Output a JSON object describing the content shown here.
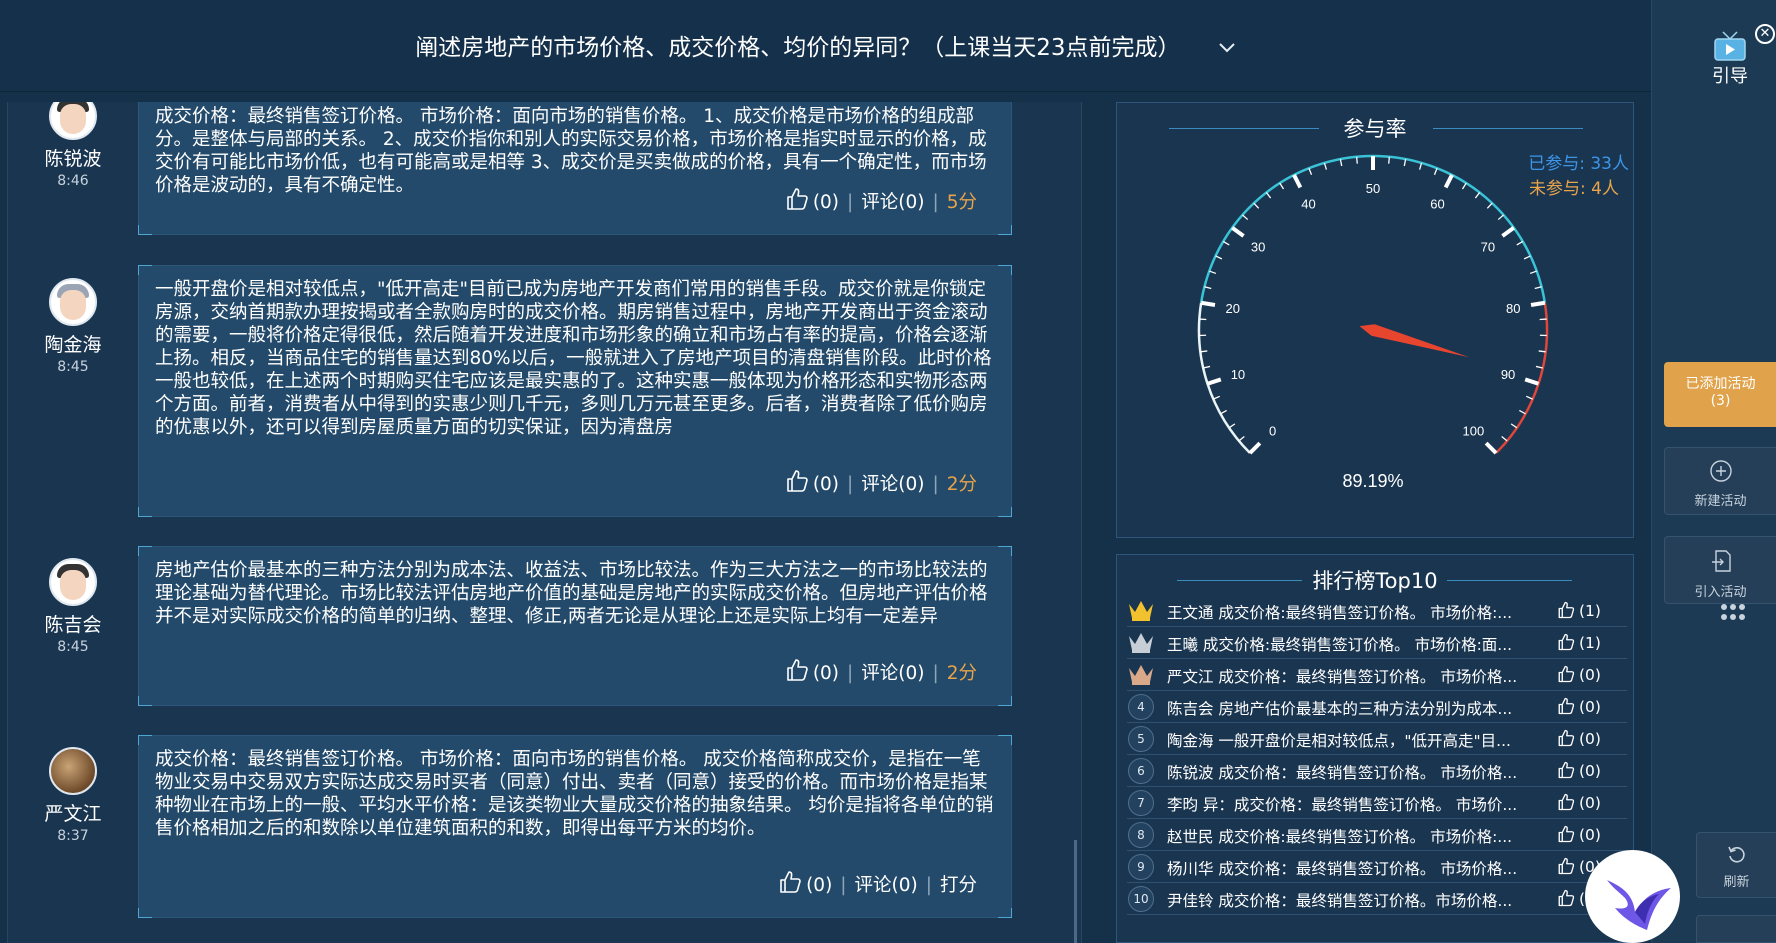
{
  "header": {
    "title": "阐述房地产的市场价格、成交价格、均价的异同？（上课当天23点前完成）"
  },
  "posts": [
    {
      "name": "陈锐波",
      "time": "8:46",
      "text": "成交价格：最终销售签订价格。 市场价格：面向市场的销售价格。 1、成交价格是市场价格的组成部分。是整体与局部的关系。 2、成交价指你和别人的实际交易价格，市场价格是指实时显示的价格，成交价有可能比市场价低，也有可能高或是相等 3、成交价是买卖做成的价格，具有一个确定性，而市场价格是波动的，具有不确定性。",
      "likes": "(0)",
      "comments": "评论(0)",
      "score": "5分"
    },
    {
      "name": "陶金海",
      "time": "8:45",
      "text": "一般开盘价是相对较低点，\"低开高走\"目前已成为房地产开发商们常用的销售手段。成交价就是你锁定房源，交纳首期款办理按揭或者全款购房时的成交价格。期房销售过程中，房地产开发商出于资金滚动的需要，一般将价格定得很低，然后随着开发进度和市场形象的确立和市场占有率的提高，价格会逐渐上扬。相反，当商品住宅的销售量达到80%以后，一般就进入了房地产项目的清盘销售阶段。此时价格一般也较低，在上述两个时期购买住宅应该是最实惠的了。这种实惠一般体现为价格形态和实物形态两个方面。前者，消费者从中得到的实惠少则几千元，多则几万元甚至更多。后者，消费者除了低价购房的优惠以外，还可以得到房屋质量方面的切实保证，因为清盘房",
      "likes": "(0)",
      "comments": "评论(0)",
      "score": "2分"
    },
    {
      "name": "陈吉会",
      "time": "8:45",
      "text": "房地产估价最基本的三种方法分别为成本法、收益法、市场比较法。作为三大方法之一的市场比较法的理论基础为替代理论。市场比较法评估房地产价值的基础是房地产的实际成交价格。但房地产评估价格并不是对实际成交价格的简单的归纳、整理、修正,两者无论是从理论上还是实际上均有一定差异",
      "likes": "(0)",
      "comments": "评论(0)",
      "score": "2分"
    },
    {
      "name": "严文江",
      "time": "8:37",
      "text": "成交价格：最终销售签订价格。 市场价格：面向市场的销售价格。 成交价格简称成交价，是指在一笔物业交易中交易双方实际达成交易时买者（同意）付出、卖者（同意）接受的价格。而市场价格是指某种物业在市场上的一般、平均水平价格：是该类物业大量成交价格的抽象结果。 均价是指将各单位的销售价格相加之后的和数除以单位建筑面积的和数，即得出每平方米的均价。",
      "likes": "(0)",
      "comments": "评论(0)",
      "score": "打分"
    }
  ],
  "participation": {
    "title": "参与率",
    "joined": "已参与: 33人",
    "not_joined": "未参与: 4人",
    "rate_label": "89.19%",
    "rate_value": 89.19,
    "ticks": [
      "0",
      "10",
      "20",
      "30",
      "40",
      "50",
      "60",
      "70",
      "80",
      "90",
      "100"
    ]
  },
  "ranking": {
    "title": "排行榜Top10",
    "rows": [
      {
        "rank": "1",
        "text": "王文通 成交价格:最终销售签订价格。 市场价格:...",
        "likes": "(1)",
        "medal": "gold"
      },
      {
        "rank": "2",
        "text": "王曦 成交价格:最终销售签订价格。 市场价格:面...",
        "likes": "(1)",
        "medal": "silver"
      },
      {
        "rank": "3",
        "text": "严文江 成交价格：最终销售签订价格。 市场价格...",
        "likes": "(0)",
        "medal": "bronze"
      },
      {
        "rank": "4",
        "text": "陈吉会 房地产估价最基本的三种方法分别为成本...",
        "likes": "(0)",
        "medal": ""
      },
      {
        "rank": "5",
        "text": "陶金海 一般开盘价是相对较低点，\"低开高走\"目...",
        "likes": "(0)",
        "medal": ""
      },
      {
        "rank": "6",
        "text": "陈锐波 成交价格：最终销售签订价格。 市场价格...",
        "likes": "(0)",
        "medal": ""
      },
      {
        "rank": "7",
        "text": "李昀 异：成交价格：最终销售签订价格。 市场价...",
        "likes": "(0)",
        "medal": ""
      },
      {
        "rank": "8",
        "text": "赵世民 成交价格:最终销售签订价格。 市场价格:...",
        "likes": "(0)",
        "medal": ""
      },
      {
        "rank": "9",
        "text": "杨川华 成交价格：最终销售签订价格。 市场价格...",
        "likes": "(0)",
        "medal": ""
      },
      {
        "rank": "10",
        "text": "尹佳铃 成交价格：最终销售签订价格。市场价格...",
        "likes": "(0)",
        "medal": ""
      }
    ]
  },
  "sidebar": {
    "guide_label": "引导",
    "added_label": "已添加活动",
    "added_count": "(3)",
    "new_label": "新建活动",
    "import_label": "引入活动",
    "refresh_label": "刷新"
  },
  "colors": {
    "accent": "#e0a24a",
    "gauge_cyan": "#3ac3d6",
    "gauge_red": "#e0473a",
    "joined": "#3d95e8"
  }
}
